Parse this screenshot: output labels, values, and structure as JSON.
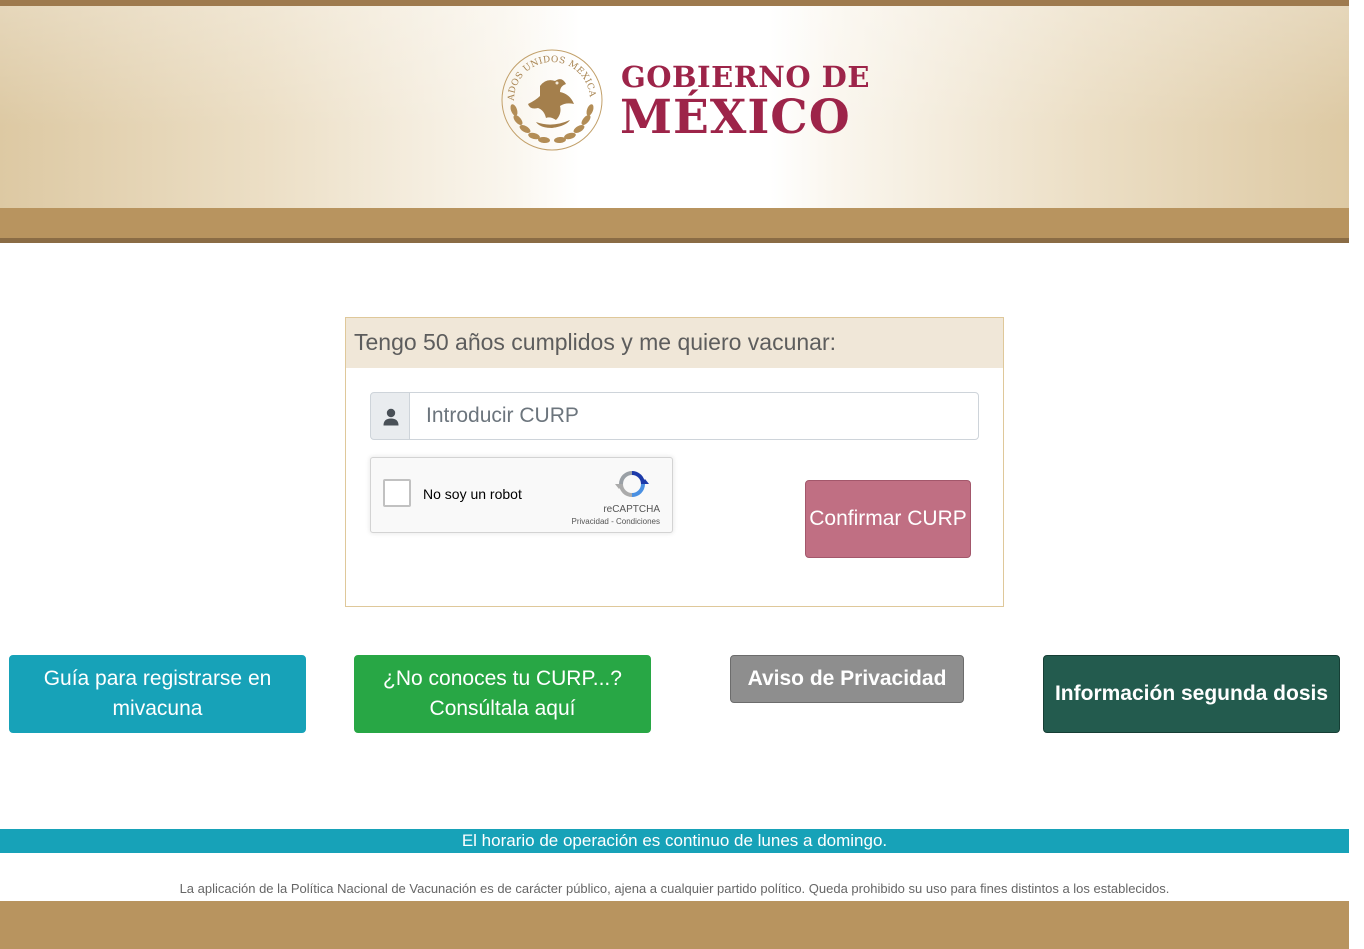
{
  "header": {
    "logo_line1": "GOBIERNO DE",
    "logo_line2": "MÉXICO",
    "seal_text": "ESTADOS UNIDOS MEXICANOS"
  },
  "form": {
    "title": "Tengo 50 años cumplidos y me quiero vacunar:",
    "curp_placeholder": "Introducir CURP",
    "confirm_label": "Confirmar CURP"
  },
  "recaptcha": {
    "label": "No soy un robot",
    "brand": "reCAPTCHA",
    "links": "Privacidad - Condiciones"
  },
  "actions": {
    "guide_label": "Guía para registrarse en mivacuna",
    "curp_lookup_label": "¿No conoces tu CURP...? Consúltala aquí",
    "privacy_label": "Aviso de Privacidad",
    "second_dose_label": "Información segunda dosis"
  },
  "footer": {
    "hours": "El horario de operación es continuo de lunes a domingo.",
    "disclaimer": "La aplicación de la Política Nacional de Vacunación es de carácter público, ajena a cualquier partido político. Queda prohibido su uso para fines distintos a los establecidos."
  },
  "colors": {
    "brand_red": "#9d2449",
    "gold": "#b8945f",
    "teal": "#17a2b8",
    "green": "#28a745",
    "dark_green": "#235b4e",
    "confirm_pink": "#c06f83",
    "gray": "#8e8e8e"
  },
  "icons": {
    "seal": "national-seal-icon",
    "user": "user-icon",
    "recaptcha": "recaptcha-icon"
  }
}
